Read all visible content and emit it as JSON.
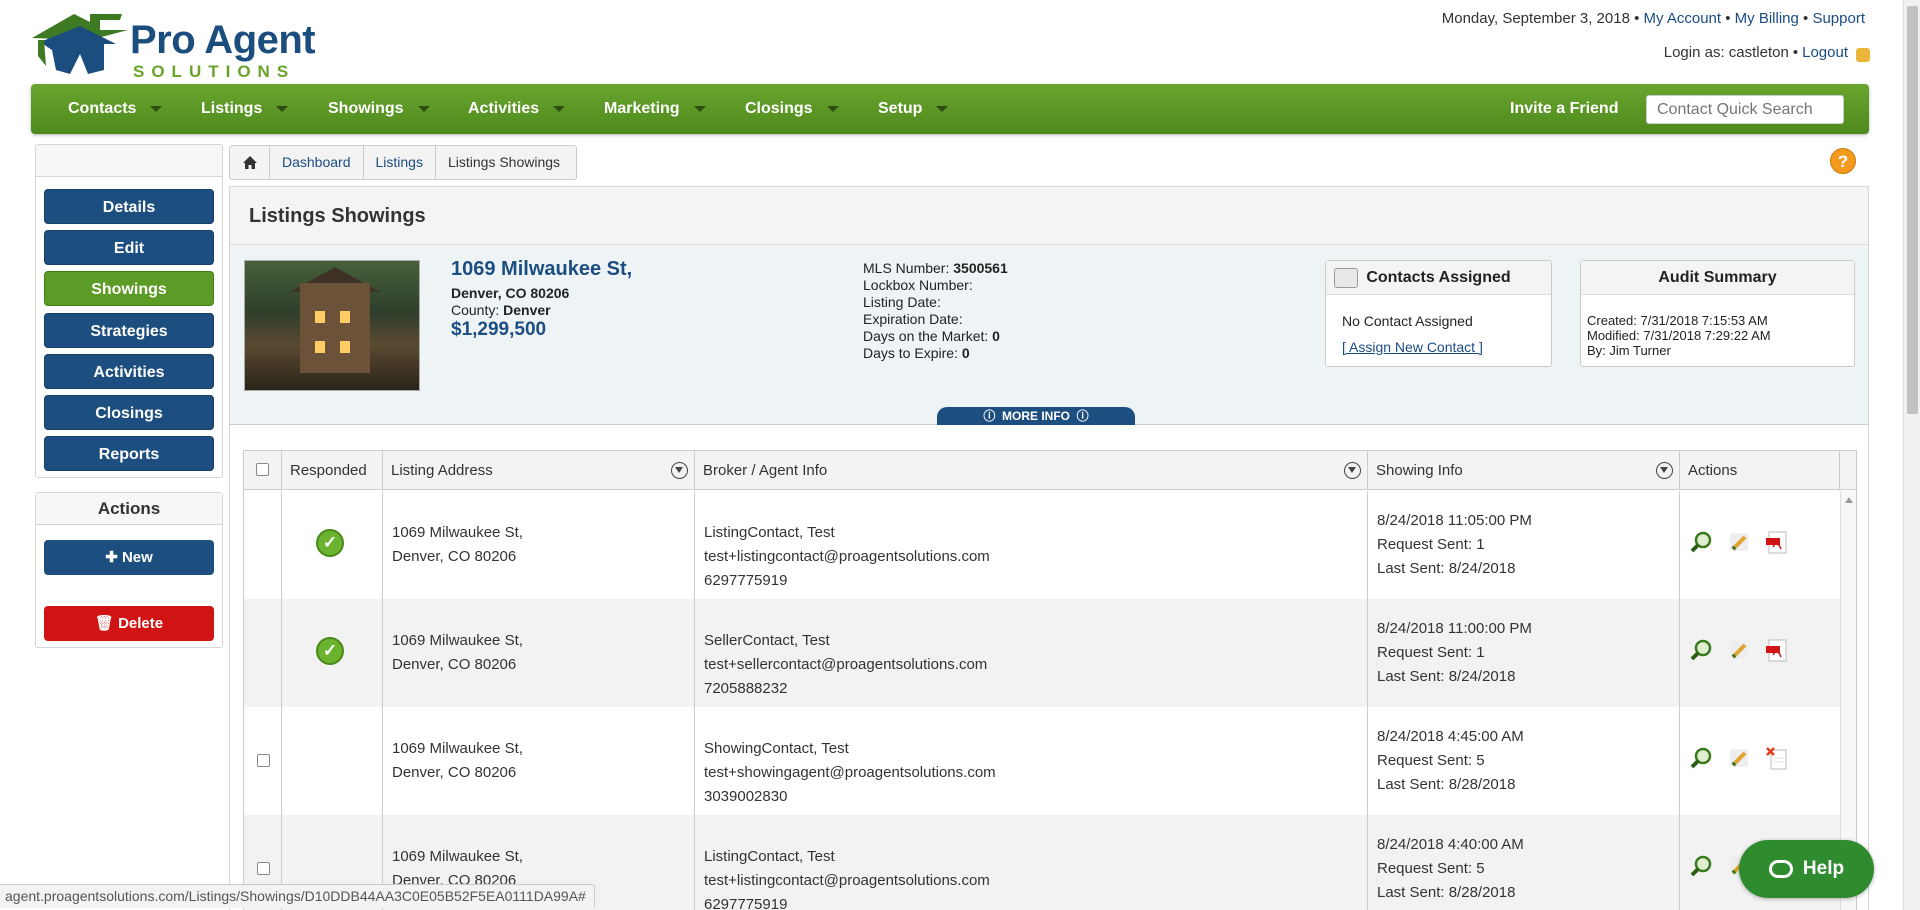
{
  "brand": {
    "name_line1": "Pro Agent",
    "name_line2": "SOLUTIONS"
  },
  "header": {
    "date": "Monday, September 3, 2018",
    "links": [
      "My Account",
      "My Billing",
      "Support"
    ],
    "login_label": "Login as: castleton",
    "logout": "Logout"
  },
  "nav": {
    "items": [
      "Contacts",
      "Listings",
      "Showings",
      "Activities",
      "Marketing",
      "Closings",
      "Setup"
    ],
    "invite": "Invite a Friend",
    "search_placeholder": "Contact Quick Search"
  },
  "sidebar": {
    "items": [
      "Details",
      "Edit",
      "Showings",
      "Strategies",
      "Activities",
      "Closings",
      "Reports"
    ],
    "active": "Showings",
    "actions_title": "Actions",
    "new_label": "New",
    "delete_label": "Delete"
  },
  "breadcrumb": [
    "Dashboard",
    "Listings",
    "Listings Showings"
  ],
  "page": {
    "title": "Listings Showings"
  },
  "listing": {
    "address": "1069 Milwaukee St,",
    "city_line": "Denver, CO 80206",
    "county_label": "County:",
    "county": "Denver",
    "price": "$1,299,500",
    "mls_label": "MLS Number:",
    "mls_number": "3500561",
    "lockbox_label": "Lockbox Number:",
    "listing_date_label": "Listing Date:",
    "expiration_label": "Expiration Date:",
    "dom_label": "Days on the Market:",
    "dom": "0",
    "dte_label": "Days to Expire:",
    "dte": "0"
  },
  "contacts_card": {
    "title": "Contacts Assigned",
    "empty": "No Contact Assigned",
    "assign_link": "[ Assign New Contact ]"
  },
  "audit_card": {
    "title": "Audit Summary",
    "created": "Created: 7/31/2018 7:15:53 AM",
    "modified": "Modified: 7/31/2018 7:29:22 AM",
    "by": "By: Jim Turner"
  },
  "more_info": "MORE INFO",
  "table": {
    "columns": [
      "Responded",
      "Listing Address",
      "Broker / Agent Info",
      "Showing Info",
      "Actions"
    ],
    "rows": [
      {
        "responded": true,
        "addr1": "1069 Milwaukee St,",
        "addr2": "Denver, CO 80206",
        "name": "ListingContact, Test",
        "email": "test+listingcontact@proagentsolutions.com",
        "phone": "6297775919",
        "showing": "8/24/2018 11:05:00 PM",
        "request": "Request Sent: 1",
        "last": "Last Sent: 8/24/2018",
        "doc": "pdf"
      },
      {
        "responded": true,
        "addr1": "1069 Milwaukee St,",
        "addr2": "Denver, CO 80206",
        "name": "SellerContact, Test",
        "email": "test+sellercontact@proagentsolutions.com",
        "phone": "7205888232",
        "showing": "8/24/2018 11:00:00 PM",
        "request": "Request Sent: 1",
        "last": "Last Sent: 8/24/2018",
        "doc": "pdf"
      },
      {
        "responded": false,
        "addr1": "1069 Milwaukee St,",
        "addr2": "Denver, CO 80206",
        "name": "ShowingContact, Test",
        "email": "test+showingagent@proagentsolutions.com",
        "phone": "3039002830",
        "showing": "8/24/2018 4:45:00 AM",
        "request": "Request Sent: 5",
        "last": "Last Sent: 8/28/2018",
        "doc": "x"
      },
      {
        "responded": false,
        "addr1": "1069 Milwaukee St,",
        "addr2": "Denver, CO 80206",
        "name": "ListingContact, Test",
        "email": "test+listingcontact@proagentsolutions.com",
        "phone": "6297775919",
        "showing": "8/24/2018 4:40:00 AM",
        "request": "Request Sent: 5",
        "last": "Last Sent: 8/28/2018",
        "doc": "x"
      }
    ]
  },
  "status_url": "agent.proagentsolutions.com/Listings/Showings/D10DDB44AA3C0E05B52F5EA0111DA99A#",
  "help_button": "Help",
  "colors": {
    "nav_green": "#5c9b25",
    "brand_blue": "#1d4e80",
    "delete_red": "#d01313"
  }
}
